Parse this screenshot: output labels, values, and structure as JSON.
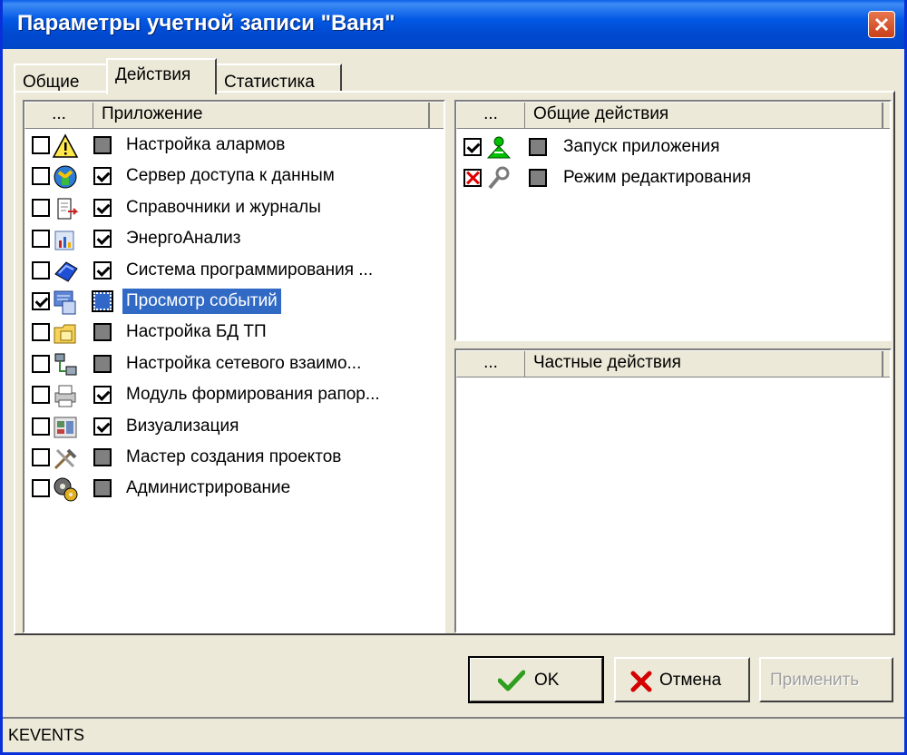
{
  "window": {
    "title": "Параметры учетной записи \"Ваня\""
  },
  "tabs": [
    {
      "label": "Общие",
      "active": false
    },
    {
      "label": "Действия",
      "active": true
    },
    {
      "label": "Статистика",
      "active": false
    }
  ],
  "apps_panel": {
    "col_dots": "...",
    "col_header": "Приложение",
    "items": [
      {
        "label": "Настройка алармов",
        "checked": false,
        "allowed": false,
        "icon": "warning-triangle-icon"
      },
      {
        "label": "Сервер доступа к данным",
        "checked": false,
        "allowed": true,
        "icon": "data-server-icon"
      },
      {
        "label": "Справочники и журналы",
        "checked": false,
        "allowed": true,
        "icon": "journal-icon"
      },
      {
        "label": "ЭнергоАнализ",
        "checked": false,
        "allowed": true,
        "icon": "energy-analysis-icon"
      },
      {
        "label": "Система программирования ...",
        "checked": false,
        "allowed": true,
        "icon": "programming-system-icon"
      },
      {
        "label": "Просмотр событий",
        "checked": true,
        "allowed": false,
        "selected": true,
        "icon": "event-viewer-icon"
      },
      {
        "label": "Настройка БД ТП",
        "checked": false,
        "allowed": false,
        "icon": "database-folder-icon"
      },
      {
        "label": "Настройка сетевого взаимо...",
        "checked": false,
        "allowed": false,
        "icon": "network-icon"
      },
      {
        "label": "Модуль формирования рапор...",
        "checked": false,
        "allowed": true,
        "icon": "report-printer-icon"
      },
      {
        "label": "Визуализация",
        "checked": false,
        "allowed": true,
        "icon": "visualization-icon"
      },
      {
        "label": "Мастер создания проектов",
        "checked": false,
        "allowed": false,
        "icon": "tools-wizard-icon"
      },
      {
        "label": "Администрирование",
        "checked": false,
        "allowed": false,
        "icon": "admin-gears-icon"
      }
    ]
  },
  "common_actions_panel": {
    "col_dots": "...",
    "col_header": "Общие действия",
    "items": [
      {
        "label": "Запуск приложения",
        "state": "checked",
        "icon": "user-launch-icon"
      },
      {
        "label": "Режим редактирования",
        "state": "denied",
        "icon": "wrench-icon"
      }
    ]
  },
  "private_actions_panel": {
    "col_dots": "...",
    "col_header": "Частные действия"
  },
  "buttons": {
    "ok": "OK",
    "cancel": "Отмена",
    "apply": "Применить"
  },
  "colors": {
    "title_bar": "#0054E3",
    "selection": "#316AC5",
    "face": "#ECE9D8",
    "close": "#D9532B"
  },
  "status": {
    "text": "KEVENTS"
  }
}
